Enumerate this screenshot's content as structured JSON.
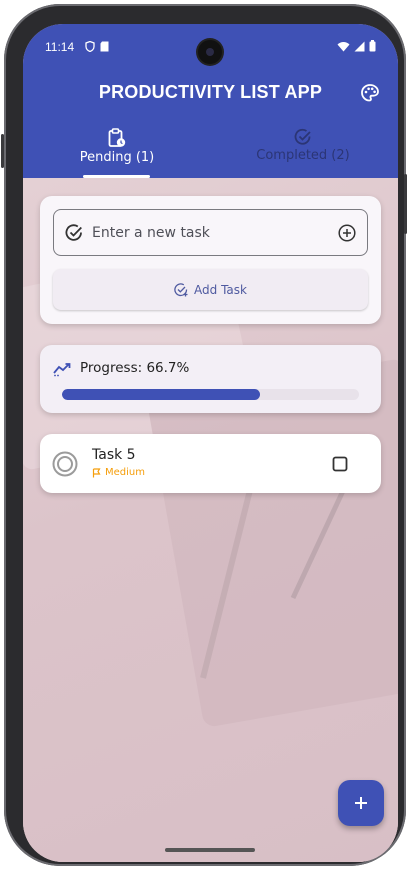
{
  "status_bar": {
    "time": "11:14"
  },
  "app": {
    "title": "PRODUCTIVITY LIST APP"
  },
  "tabs": [
    {
      "label": "Pending (1)",
      "icon": "clipboard-clock-icon",
      "selected": true
    },
    {
      "label": "Completed (2)",
      "icon": "check-circle-icon",
      "selected": false
    }
  ],
  "new_task": {
    "placeholder": "Enter a new task",
    "value": "",
    "add_label": "Add Task"
  },
  "progress": {
    "label": "Progress: 66.7%",
    "fraction": 0.667
  },
  "tasks": [
    {
      "title": "Task 5",
      "priority": "Medium",
      "done": false
    }
  ],
  "colors": {
    "primary": "#3f51b5",
    "background": "#dcc4ca",
    "priority_medium": "#f59e0b"
  }
}
